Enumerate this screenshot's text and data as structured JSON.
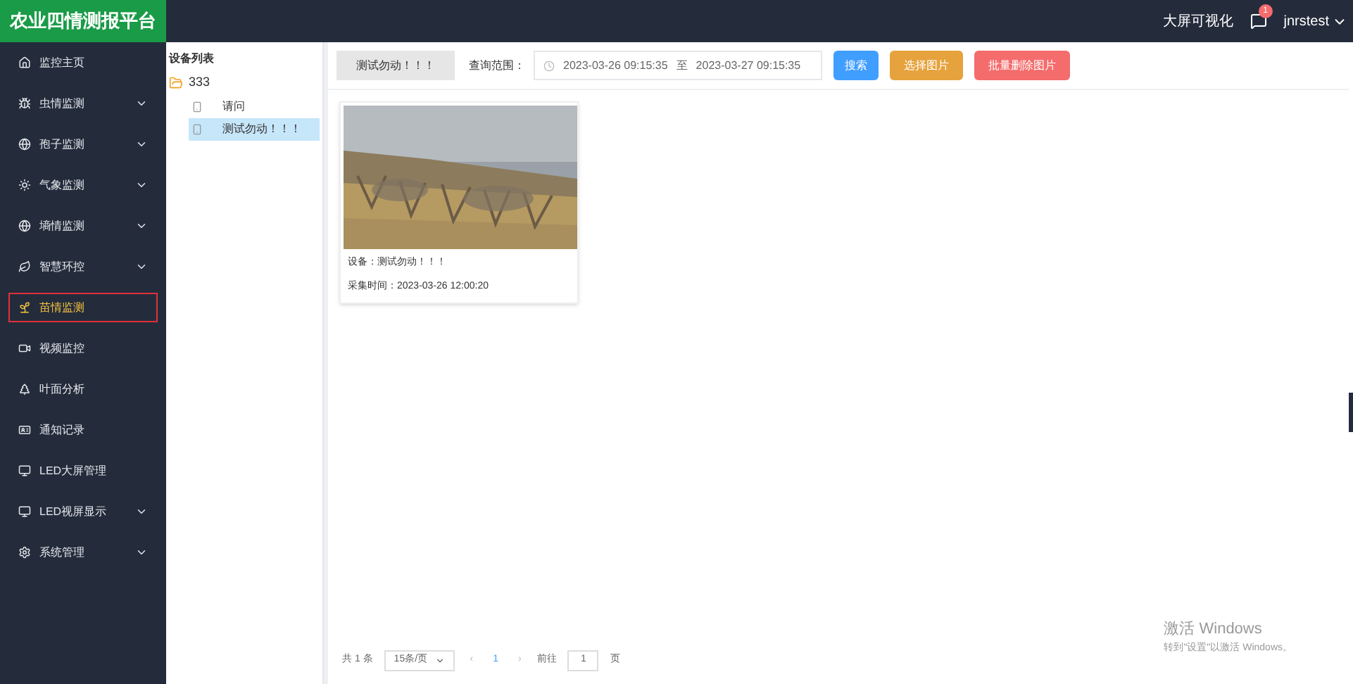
{
  "logo": "农业四情测报平台",
  "header": {
    "link": "大屏可视化",
    "badge": "1",
    "user": "jnrstest"
  },
  "sidebar": {
    "items": [
      {
        "label": "监控主页",
        "expandable": false,
        "selected": false
      },
      {
        "label": "虫情监测",
        "expandable": true,
        "selected": false
      },
      {
        "label": "孢子监测",
        "expandable": true,
        "selected": false
      },
      {
        "label": "气象监测",
        "expandable": true,
        "selected": false
      },
      {
        "label": "墒情监测",
        "expandable": true,
        "selected": false
      },
      {
        "label": "智慧环控",
        "expandable": true,
        "selected": false
      },
      {
        "label": "苗情监测",
        "expandable": false,
        "selected": true
      },
      {
        "label": "视频监控",
        "expandable": false,
        "selected": false
      },
      {
        "label": "叶面分析",
        "expandable": false,
        "selected": false
      },
      {
        "label": "通知记录",
        "expandable": false,
        "selected": false
      },
      {
        "label": "LED大屏管理",
        "expandable": false,
        "selected": false
      },
      {
        "label": "LED视屏显示",
        "expandable": true,
        "selected": false
      },
      {
        "label": "系统管理",
        "expandable": true,
        "selected": false
      }
    ]
  },
  "device_tree": {
    "title": "设备列表",
    "root": {
      "label": "333",
      "children": [
        {
          "label": "请问",
          "selected": false
        },
        {
          "label": "测试勿动！！！",
          "selected": true
        }
      ]
    }
  },
  "toolbar": {
    "device": "测试勿动！！！",
    "range_label": "查询范围：",
    "start": "2023-03-26 09:15:35",
    "separator": "至",
    "end": "2023-03-27 09:15:35",
    "buttons": [
      {
        "label": "搜索",
        "kind": "primary"
      },
      {
        "label": "选择图片",
        "kind": "warning"
      },
      {
        "label": "批量删除图片",
        "kind": "danger"
      }
    ]
  },
  "cards": [
    {
      "kind": "picture",
      "device": "设备：测试勿动！！！",
      "time": "采集时间：2023-03-26 12:00:20"
    }
  ],
  "pagination": {
    "total": "共 1 条",
    "page_size": "15条/页",
    "prev": "‹",
    "current": "1",
    "next": "›",
    "goto_label": "前往",
    "goto_value": "1",
    "goto_suffix": "页"
  },
  "activation": {
    "title": "激活 Windows",
    "hint": "转到\"设置\"以激活 Windows。"
  }
}
